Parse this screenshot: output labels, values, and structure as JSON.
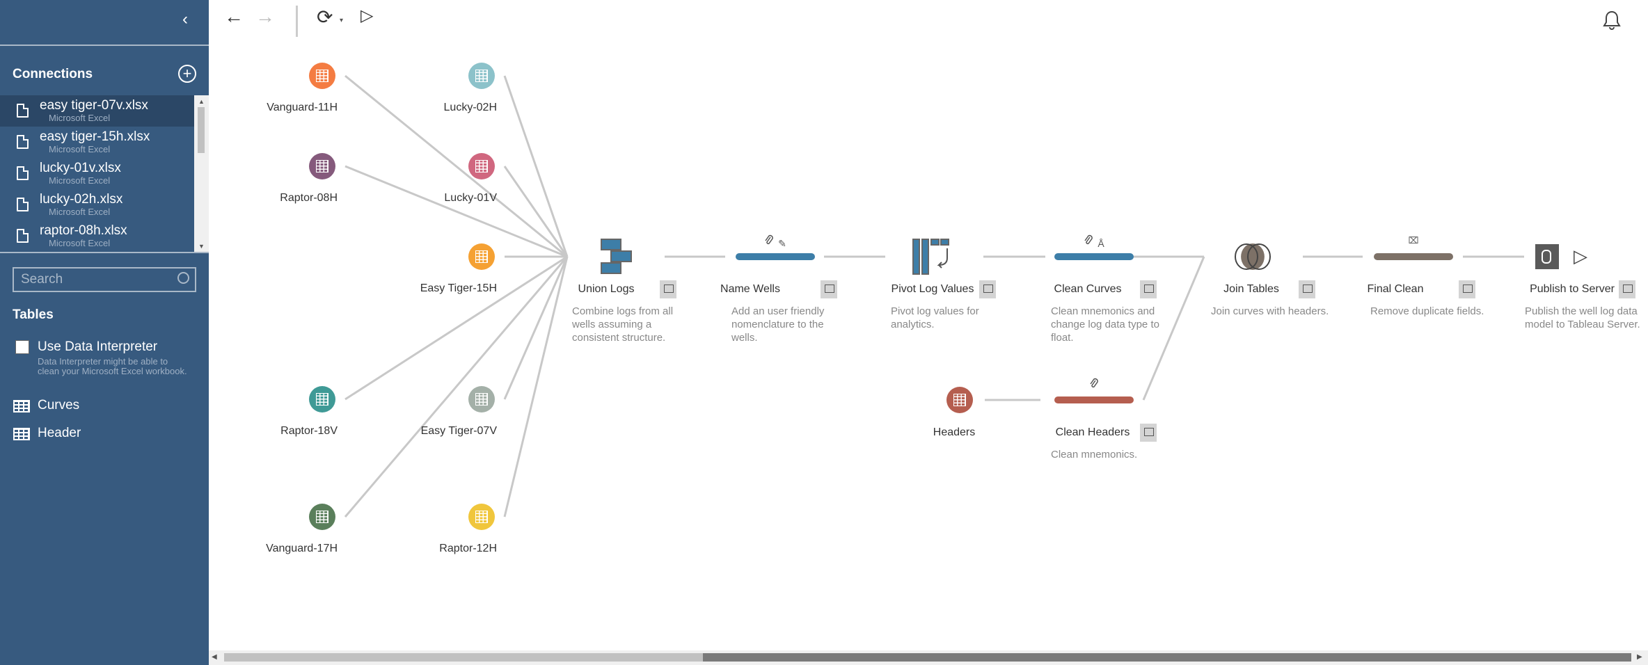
{
  "sidebar": {
    "collapse_icon": "chevron-left",
    "connections_title": "Connections",
    "add_icon": "plus-circle",
    "connections": [
      {
        "name": "easy tiger-07v.xlsx",
        "type": "Microsoft Excel",
        "selected": true
      },
      {
        "name": "easy tiger-15h.xlsx",
        "type": "Microsoft Excel"
      },
      {
        "name": "lucky-01v.xlsx",
        "type": "Microsoft Excel"
      },
      {
        "name": "lucky-02h.xlsx",
        "type": "Microsoft Excel"
      },
      {
        "name": "raptor-08h.xlsx",
        "type": "Microsoft Excel"
      }
    ],
    "search_placeholder": "Search",
    "tables_title": "Tables",
    "interpreter_label": "Use Data Interpreter",
    "interpreter_hint_1": "Data Interpreter might be able to",
    "interpreter_hint_2": "clean your Microsoft Excel workbook.",
    "interpreter_checked": false,
    "tables": [
      "Curves",
      "Header"
    ]
  },
  "toolbar": {
    "back": "←",
    "forward": "→",
    "refresh": "⟳",
    "run": "▷",
    "bell": "bell"
  },
  "sources": [
    {
      "label": "Vanguard-11H",
      "color": "#f47c42"
    },
    {
      "label": "Lucky-02H",
      "color": "#8cc2ca"
    },
    {
      "label": "Raptor-08H",
      "color": "#855a7c"
    },
    {
      "label": "Lucky-01V",
      "color": "#d0677f"
    },
    {
      "label": "Easy Tiger-15H",
      "color": "#f5a133"
    },
    {
      "label": "Raptor-18V",
      "color": "#3f9a96"
    },
    {
      "label": "Easy Tiger-07V",
      "color": "#a4b0a8"
    },
    {
      "label": "Vanguard-17H",
      "color": "#5a7f5b"
    },
    {
      "label": "Raptor-12H",
      "color": "#f0c63c"
    }
  ],
  "steps": [
    {
      "label": "Union Logs",
      "desc": "Combine logs from all wells assuming a consistent structure.",
      "kind": "union",
      "color": "#3d7ea8"
    },
    {
      "label": "Name Wells",
      "desc": "Add an user friendly nomenclature to the wells.",
      "kind": "clean",
      "color": "#3d7ea8"
    },
    {
      "label": "Pivot Log Values",
      "desc": "Pivot log values for analytics.",
      "kind": "pivot",
      "color": "#3d7ea8"
    },
    {
      "label": "Clean Curves",
      "desc": "Clean mnemonics and change log data type to float.",
      "kind": "clean",
      "color": "#3d7ea8"
    },
    {
      "label": "Join Tables",
      "desc": "Join curves with headers.",
      "kind": "join",
      "color": "#7d7167"
    },
    {
      "label": "Final Clean",
      "desc": "Remove duplicate fields.",
      "kind": "clean",
      "color": "#7d7167"
    },
    {
      "label": "Publish to Server",
      "desc": "Publish the well log data model to Tableau Server.",
      "kind": "output",
      "color": "#5a5a5a"
    },
    {
      "label": "Headers",
      "desc": "",
      "kind": "input",
      "color": "#b55e4f"
    },
    {
      "label": "Clean Headers",
      "desc": "Clean mnemonics.",
      "kind": "clean",
      "color": "#b55e4f"
    }
  ]
}
